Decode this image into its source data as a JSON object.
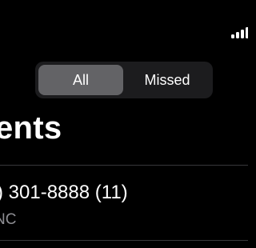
{
  "status_bar": {
    "signal_icon": "cellular-signal-icon",
    "signal_level": 0.75
  },
  "segmented_control": {
    "options": [
      {
        "label": "All",
        "selected": true
      },
      {
        "label": "Missed",
        "selected": false
      }
    ]
  },
  "title": "ents",
  "calls": [
    {
      "number": ") 301-8888 (11)",
      "location": "NC"
    }
  ],
  "colors": {
    "background": "#000000",
    "segment_track": "#1c1c1e",
    "segment_selected": "#636366",
    "secondary_text": "#8e8e93",
    "divider": "#38383a"
  }
}
